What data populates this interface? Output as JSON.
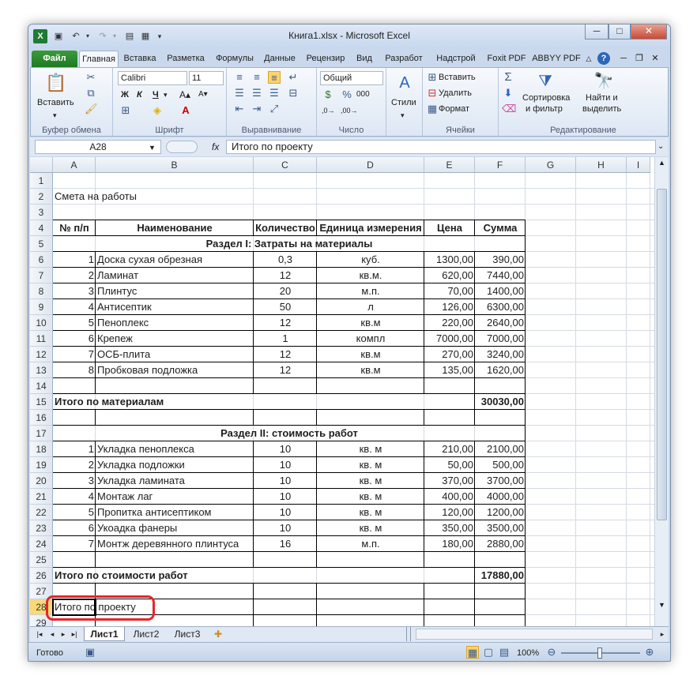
{
  "window": {
    "title": "Книга1.xlsx - Microsoft Excel",
    "min_label": "─",
    "max_label": "□",
    "close_label": "✕"
  },
  "ribbon_tabs": [
    "Файл",
    "Главная",
    "Вставка",
    "Разметка",
    "Формулы",
    "Данные",
    "Рецензир",
    "Вид",
    "Разработ",
    "Надстрой",
    "Foxit PDF",
    "ABBYY PDF"
  ],
  "ribbon": {
    "clipboard": {
      "paste": "Вставить",
      "group": "Буфер обмена"
    },
    "font": {
      "name": "Calibri",
      "size": "11",
      "bold": "Ж",
      "italic": "К",
      "underline": "Ч",
      "group": "Шрифт"
    },
    "alignment": {
      "group": "Выравнивание"
    },
    "number": {
      "format": "Общий",
      "group": "Число"
    },
    "styles": {
      "label": "Стили"
    },
    "cells": {
      "insert": "Вставить",
      "delete": "Удалить",
      "format": "Формат",
      "group": "Ячейки"
    },
    "editing": {
      "sort_line1": "Сортировка",
      "sort_line2": "и фильтр",
      "find_line1": "Найти и",
      "find_line2": "выделить",
      "group": "Редактирование"
    }
  },
  "formula_bar": {
    "name_box": "A28",
    "fx": "fx",
    "value": "Итого по проекту"
  },
  "columns": [
    "A",
    "B",
    "C",
    "D",
    "E",
    "F",
    "G",
    "H",
    "I"
  ],
  "rows": [
    {
      "n": "1",
      "a": "",
      "b": "",
      "c": "",
      "d": "",
      "e": "",
      "f": ""
    },
    {
      "n": "2",
      "a": "Смета на работы",
      "b": "",
      "c": "",
      "d": "",
      "e": "",
      "f": ""
    },
    {
      "n": "3",
      "a": "",
      "b": "",
      "c": "",
      "d": "",
      "e": "",
      "f": ""
    },
    {
      "n": "4",
      "a": "№ п/п",
      "b": "Наименование",
      "c": "Количество",
      "d": "Единица измерения",
      "e": "Цена",
      "f": "Сумма"
    },
    {
      "n": "5",
      "a": "Раздел I: Затраты на материалы",
      "b": "",
      "c": "",
      "d": "",
      "e": "",
      "f": ""
    },
    {
      "n": "6",
      "a": "1",
      "b": "Доска сухая обрезная",
      "c": "0,3",
      "d": "куб.",
      "e": "1300,00",
      "f": "390,00"
    },
    {
      "n": "7",
      "a": "2",
      "b": "Ламинат",
      "c": "12",
      "d": "кв.м.",
      "e": "620,00",
      "f": "7440,00"
    },
    {
      "n": "8",
      "a": "3",
      "b": "Плинтус",
      "c": "20",
      "d": "м.п.",
      "e": "70,00",
      "f": "1400,00"
    },
    {
      "n": "9",
      "a": "4",
      "b": "Антисептик",
      "c": "50",
      "d": "л",
      "e": "126,00",
      "f": "6300,00"
    },
    {
      "n": "10",
      "a": "5",
      "b": "Пеноплекс",
      "c": "12",
      "d": "кв.м",
      "e": "220,00",
      "f": "2640,00"
    },
    {
      "n": "11",
      "a": "6",
      "b": "Крепеж",
      "c": "1",
      "d": "компл",
      "e": "7000,00",
      "f": "7000,00"
    },
    {
      "n": "12",
      "a": "7",
      "b": "ОСБ-плита",
      "c": "12",
      "d": "кв.м",
      "e": "270,00",
      "f": "3240,00"
    },
    {
      "n": "13",
      "a": "8",
      "b": "Пробковая подложка",
      "c": "12",
      "d": "кв.м",
      "e": "135,00",
      "f": "1620,00"
    },
    {
      "n": "14",
      "a": "",
      "b": "",
      "c": "",
      "d": "",
      "e": "",
      "f": ""
    },
    {
      "n": "15",
      "a": "Итого по материалам",
      "b": "",
      "c": "",
      "d": "",
      "e": "",
      "f": "30030,00"
    },
    {
      "n": "16",
      "a": "",
      "b": "",
      "c": "",
      "d": "",
      "e": "",
      "f": ""
    },
    {
      "n": "17",
      "a": "Раздел II: стоимость работ",
      "b": "",
      "c": "",
      "d": "",
      "e": "",
      "f": ""
    },
    {
      "n": "18",
      "a": "1",
      "b": "Укладка пеноплекса",
      "c": "10",
      "d": "кв. м",
      "e": "210,00",
      "f": "2100,00"
    },
    {
      "n": "19",
      "a": "2",
      "b": "Укладка подложки",
      "c": "10",
      "d": "кв. м",
      "e": "50,00",
      "f": "500,00"
    },
    {
      "n": "20",
      "a": "3",
      "b": "Укладка  ламината",
      "c": "10",
      "d": "кв. м",
      "e": "370,00",
      "f": "3700,00"
    },
    {
      "n": "21",
      "a": "4",
      "b": "Монтаж лаг",
      "c": "10",
      "d": "кв. м",
      "e": "400,00",
      "f": "4000,00"
    },
    {
      "n": "22",
      "a": "5",
      "b": "Пропитка антисептиком",
      "c": "10",
      "d": "кв. м",
      "e": "120,00",
      "f": "1200,00"
    },
    {
      "n": "23",
      "a": "6",
      "b": "Укоадка фанеры",
      "c": "10",
      "d": "кв. м",
      "e": "350,00",
      "f": "3500,00"
    },
    {
      "n": "24",
      "a": "7",
      "b": "Монтж деревянного плинтуса",
      "c": "16",
      "d": "м.п.",
      "e": "180,00",
      "f": "2880,00"
    },
    {
      "n": "25",
      "a": "",
      "b": "",
      "c": "",
      "d": "",
      "e": "",
      "f": ""
    },
    {
      "n": "26",
      "a": "Итого по стоимости работ",
      "b": "",
      "c": "",
      "d": "",
      "e": "",
      "f": "17880,00"
    },
    {
      "n": "27",
      "a": "",
      "b": "",
      "c": "",
      "d": "",
      "e": "",
      "f": ""
    },
    {
      "n": "28",
      "a": "Итого по проекту",
      "b": "",
      "c": "",
      "d": "",
      "e": "",
      "f": ""
    },
    {
      "n": "29",
      "a": "",
      "b": "",
      "c": "",
      "d": "",
      "e": "",
      "f": ""
    }
  ],
  "sheets": [
    "Лист1",
    "Лист2",
    "Лист3"
  ],
  "status": {
    "ready": "Готово",
    "zoom": "100%"
  },
  "colors": {
    "highlight": "#e8242a",
    "file_tab": "#2a8a2c"
  }
}
